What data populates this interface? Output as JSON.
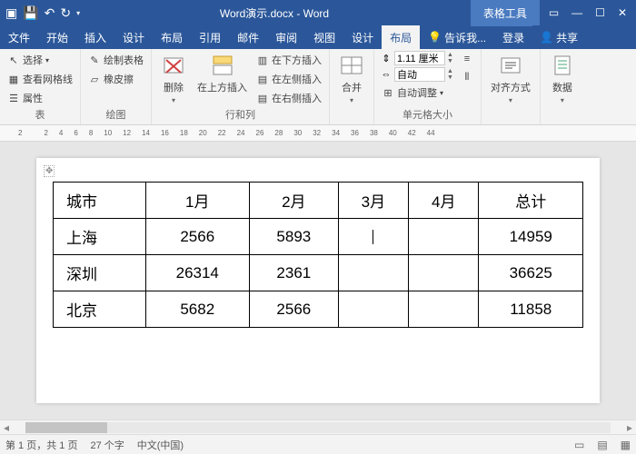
{
  "titlebar": {
    "doc_title": "Word演示.docx - Word",
    "tool_tab": "表格工具"
  },
  "menu": {
    "file": "文件",
    "home": "开始",
    "insert": "插入",
    "design": "设计",
    "layout1": "布局",
    "references": "引用",
    "mail": "邮件",
    "review": "审阅",
    "view": "视图",
    "tbl_design": "设计",
    "tbl_layout": "布局",
    "tell_me": "告诉我...",
    "signin": "登录",
    "share": "共享"
  },
  "ribbon": {
    "sel": "选择",
    "gridlines": "查看网格线",
    "props": "属性",
    "g_table": "表",
    "draw": "绘制表格",
    "eraser": "橡皮擦",
    "g_draw": "绘图",
    "delete": "删除",
    "ins_above": "在上方插入",
    "ins_below": "在下方插入",
    "ins_left": "在左侧插入",
    "ins_right": "在右侧插入",
    "g_rowscols": "行和列",
    "merge": "合并",
    "height_val": "1.11 厘米",
    "auto": "自动",
    "autofit": "自动调整",
    "g_cellsize": "单元格大小",
    "align": "对齐方式",
    "data": "数据"
  },
  "ruler": [
    "2",
    "",
    "2",
    "4",
    "6",
    "8",
    "10",
    "12",
    "14",
    "16",
    "18",
    "20",
    "22",
    "24",
    "26",
    "28",
    "30",
    "32",
    "34",
    "36",
    "38",
    "40",
    "42",
    "44"
  ],
  "table": {
    "header": [
      "城市",
      "1月",
      "2月",
      "3月",
      "4月",
      "总计"
    ],
    "rows": [
      [
        "上海",
        "2566",
        "5893",
        "",
        "",
        "14959"
      ],
      [
        "深圳",
        "26314",
        "2361",
        "",
        "",
        "36625"
      ],
      [
        "北京",
        "5682",
        "2566",
        "",
        "",
        "11858"
      ]
    ]
  },
  "status": {
    "page": "第 1 页，共 1 页",
    "words": "27 个字",
    "lang": "中文(中国)"
  }
}
